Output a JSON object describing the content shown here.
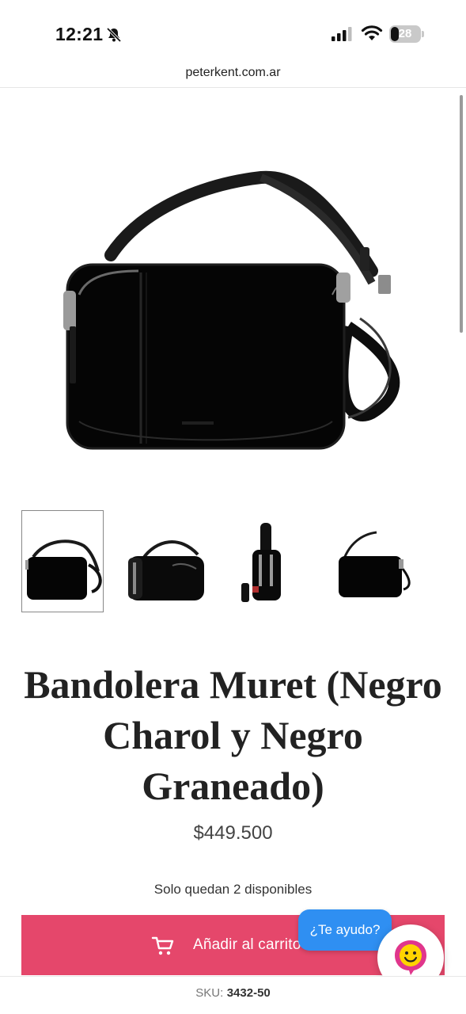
{
  "status_bar": {
    "time": "12:21",
    "battery": "28"
  },
  "browser": {
    "url": "peterkent.com.ar"
  },
  "product": {
    "title": "Bandolera Muret (Negro Charol y Negro Graneado)",
    "price": "$449.500",
    "stock_note": "Solo quedan 2 disponibles",
    "add_to_cart_label": "Añadir al carrito",
    "sku_label": "SKU:",
    "sku_value": "3432-50"
  },
  "chat_widget": {
    "label": "¿Te ayudo?"
  },
  "colors": {
    "accent": "#e5476b",
    "chat_blue": "#2f8ff2",
    "chat_avatar": "#e0368c"
  },
  "icons": {
    "bell": "bell-slash-icon",
    "signal": "cellular-signal-icon",
    "wifi": "wifi-icon",
    "battery": "battery-icon",
    "cart": "cart-icon",
    "chat": "chat-avatar-icon"
  }
}
